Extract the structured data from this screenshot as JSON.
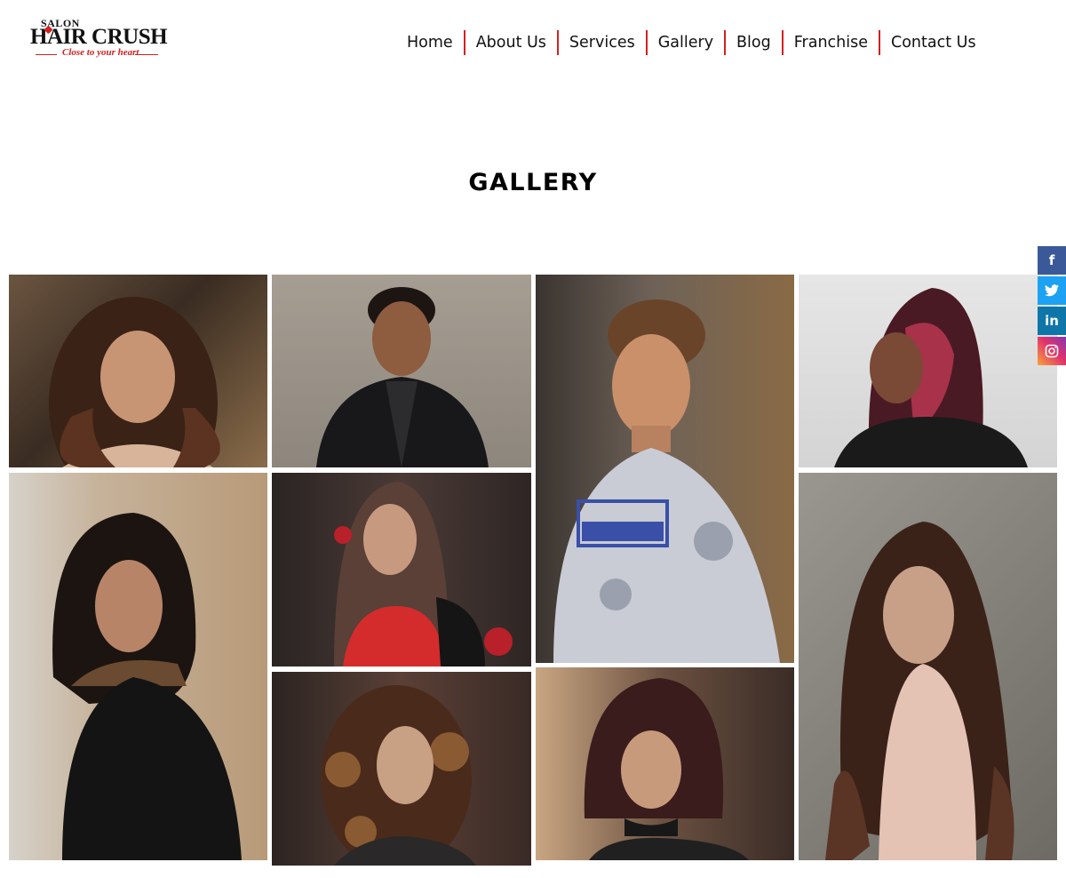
{
  "brand": {
    "salon": "SALON",
    "name": "HAIR CRUSH",
    "tagline": "Close to your heart"
  },
  "nav": {
    "items": [
      "Home",
      "About Us",
      "Services",
      "Gallery",
      "Blog",
      "Franchise",
      "Contact Us"
    ]
  },
  "page": {
    "title": "GALLERY"
  },
  "gallery": {
    "photos": [
      "woman-wavy-brown-hair",
      "man-black-blazer",
      "man-camo-tshirt",
      "woman-red-highlights",
      "woman-bob-black-sweater",
      "woman-straight-red-top",
      "woman-long-waves-pink-top",
      "woman-curly-hair",
      "woman-short-burgundy-hair"
    ]
  },
  "social": {
    "facebook": "f",
    "twitter": "t",
    "linkedin": "in",
    "instagram": "ig"
  },
  "colors": {
    "accent": "#d32020",
    "facebook": "#3b5998",
    "twitter": "#1da1f2",
    "linkedin": "#0e76a8"
  }
}
